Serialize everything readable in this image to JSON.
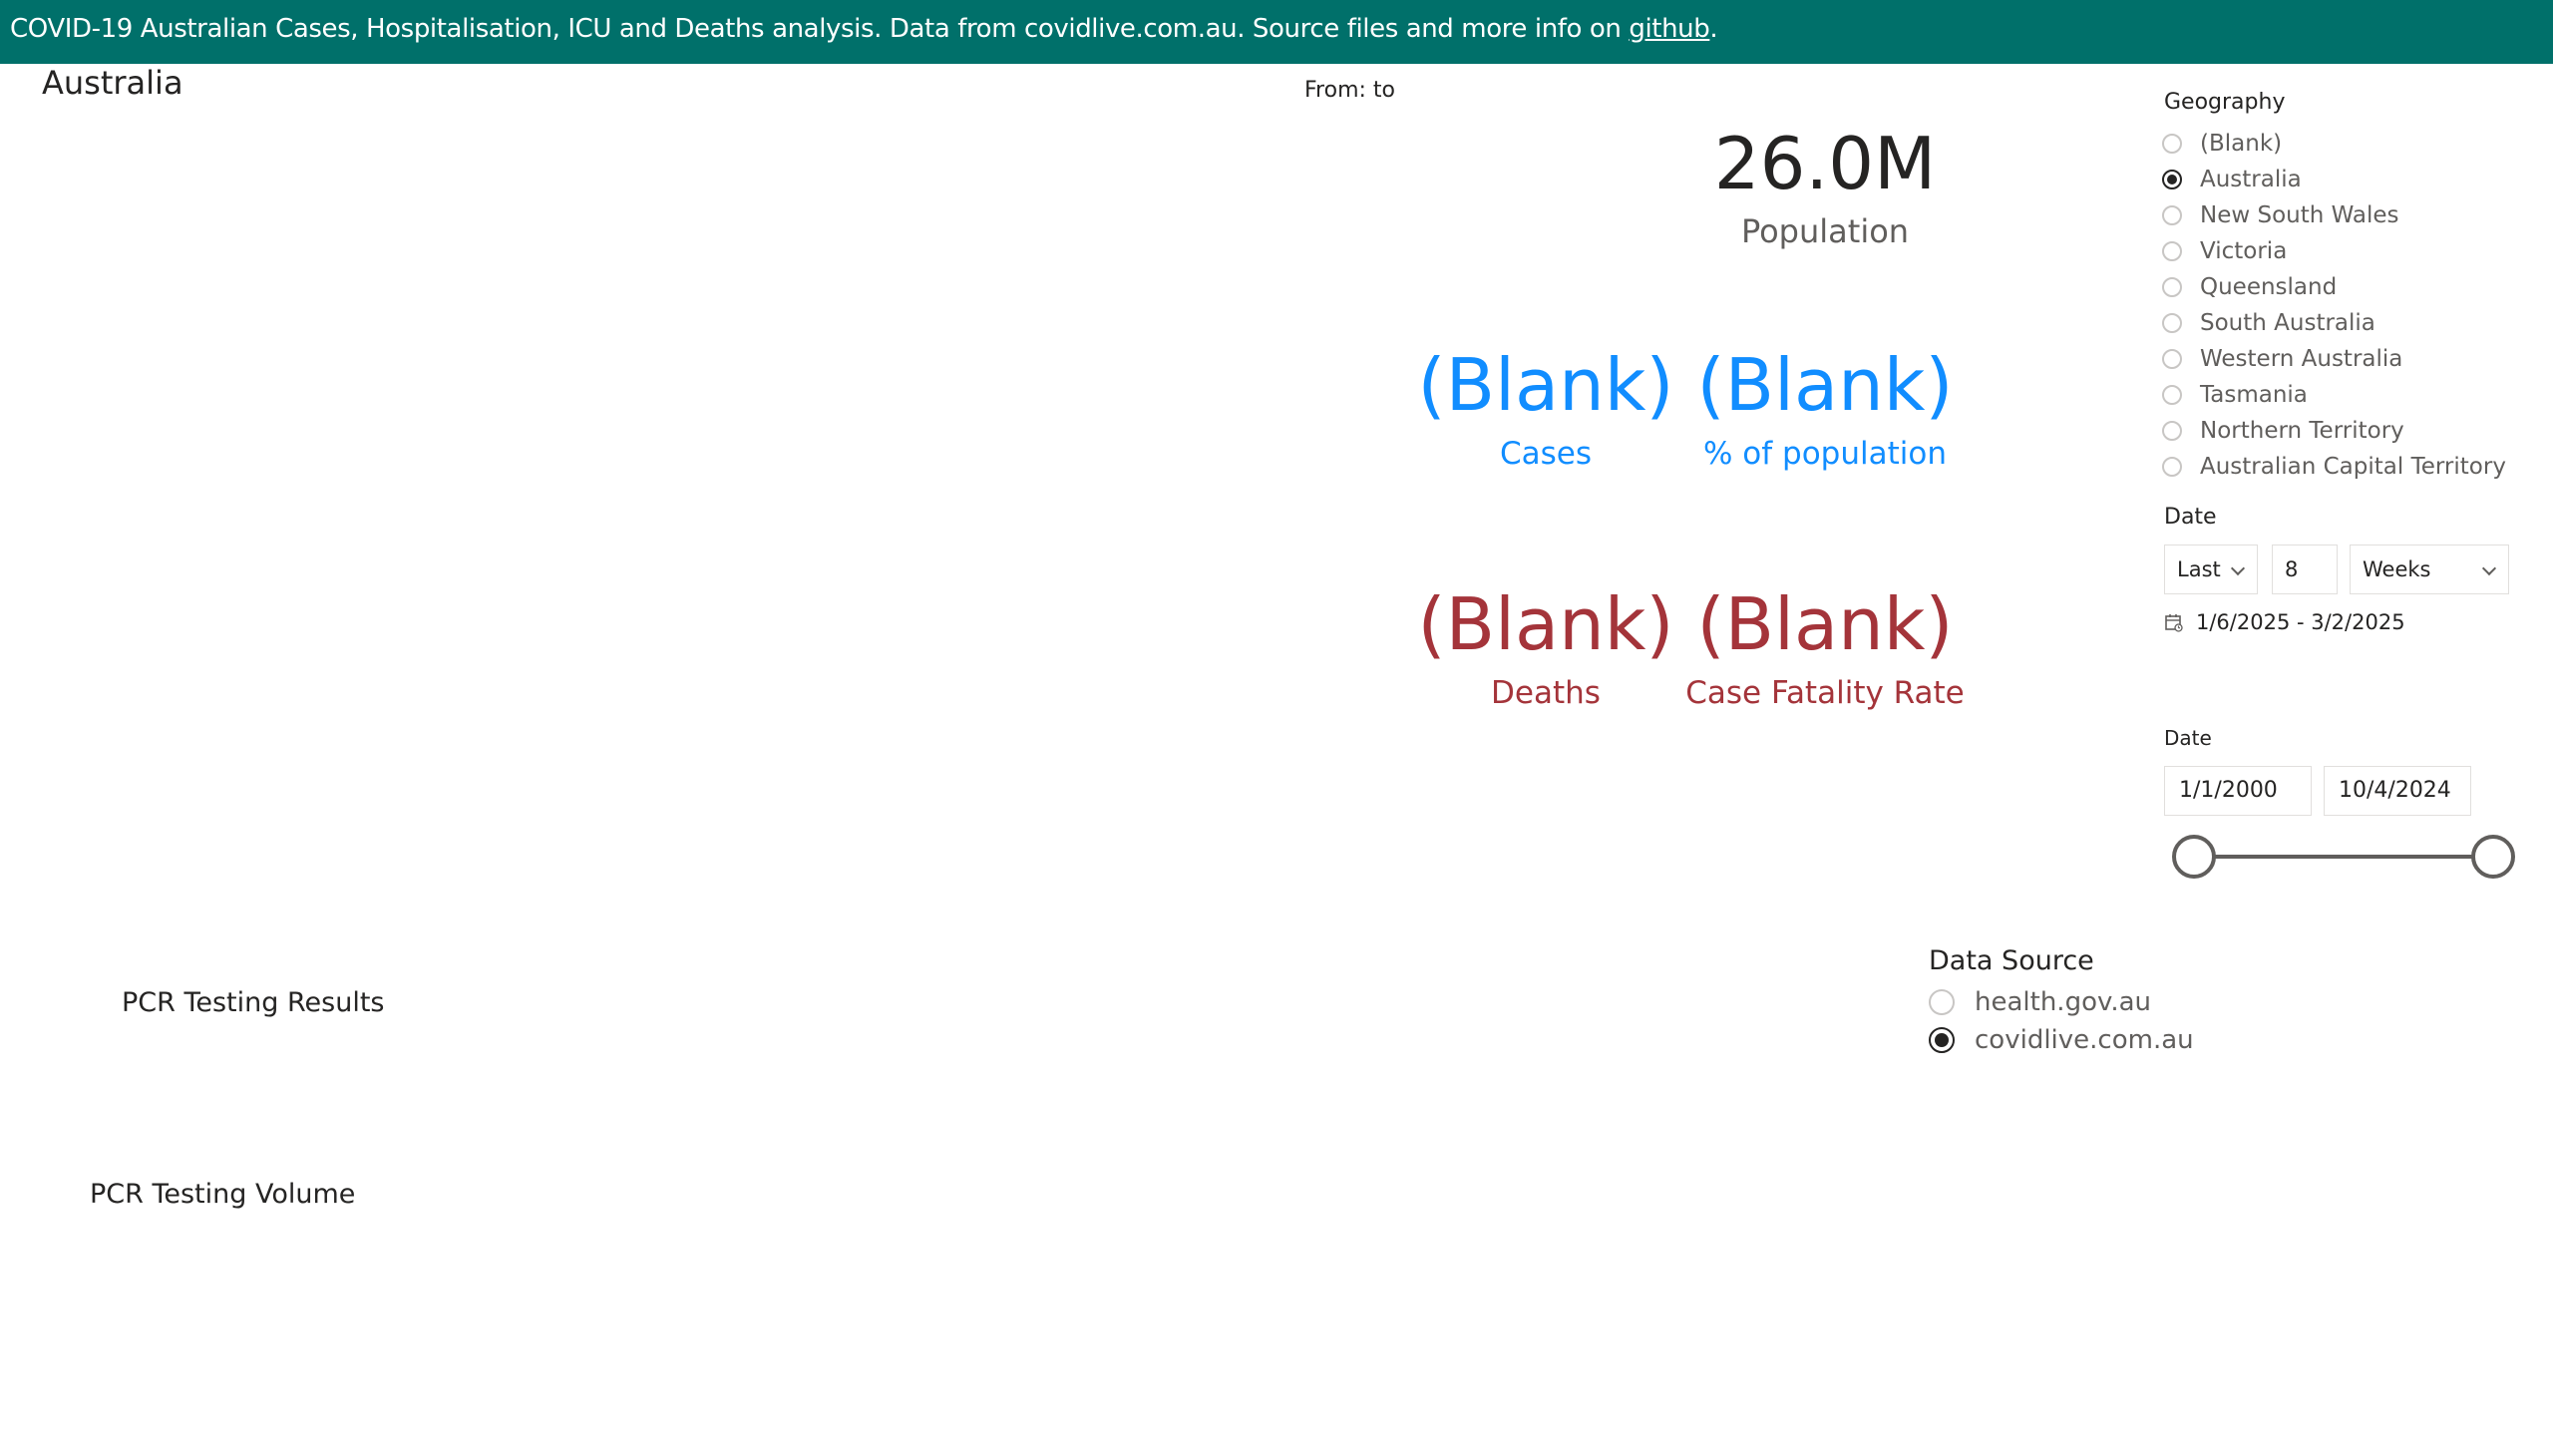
{
  "banner": {
    "text": "COVID-19 Australian Cases, Hospitalisation, ICU and Deaths analysis. Data from covidlive.com.au. Source files and more info on ",
    "link_label": "github",
    "suffix": "."
  },
  "report": {
    "geography_title": "Australia",
    "from_to": "From: to"
  },
  "kpis": {
    "population": {
      "value": "26.0M",
      "label": "Population"
    },
    "cases": {
      "value": "(Blank)",
      "label": "Cases"
    },
    "pct_population": {
      "value": "(Blank)",
      "label": "% of population"
    },
    "deaths": {
      "value": "(Blank)",
      "label": "Deaths"
    },
    "cfr": {
      "value": "(Blank)",
      "label": "Case Fatality Rate"
    }
  },
  "geography_slicer": {
    "title": "Geography",
    "options": [
      {
        "label": "(Blank)",
        "selected": false
      },
      {
        "label": "Australia",
        "selected": true
      },
      {
        "label": "New South Wales",
        "selected": false
      },
      {
        "label": "Victoria",
        "selected": false
      },
      {
        "label": "Queensland",
        "selected": false
      },
      {
        "label": "South Australia",
        "selected": false
      },
      {
        "label": "Western Australia",
        "selected": false
      },
      {
        "label": "Tasmania",
        "selected": false
      },
      {
        "label": "Northern Territory",
        "selected": false
      },
      {
        "label": "Australian Capital Territory",
        "selected": false
      }
    ]
  },
  "relative_date_slicer": {
    "title": "Date",
    "mode": "Last",
    "count": "8",
    "unit": "Weeks",
    "range_text": "1/6/2025 - 3/2/2025",
    "icon": "calendar-icon"
  },
  "between_date_slicer": {
    "title": "Date",
    "start": "1/1/2000",
    "end": "10/4/2024",
    "start_fraction": 0,
    "end_fraction": 1
  },
  "data_source_slicer": {
    "title": "Data Source",
    "options": [
      {
        "label": "health.gov.au",
        "selected": false
      },
      {
        "label": "covidlive.com.au",
        "selected": true
      }
    ]
  },
  "sections": {
    "pcr_results": "PCR Testing Results",
    "pcr_volume": "PCR Testing Volume"
  },
  "colors": {
    "banner": "#00706a",
    "blue_kpi": "#118dff",
    "red_kpi": "#a4343a"
  }
}
